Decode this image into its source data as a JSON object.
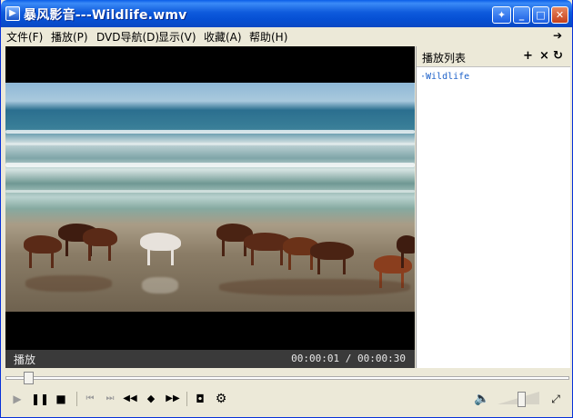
{
  "window": {
    "title": "暴风影音---Wildlife.wmv"
  },
  "menu": {
    "items": [
      "文件(F)",
      "播放(P)",
      "DVD导航(D)",
      "显示(V)",
      "收藏(A)",
      "帮助(H)"
    ]
  },
  "status": {
    "label": "播放",
    "time": "00:00:01 / 00:00:30"
  },
  "playlist": {
    "title": "播放列表",
    "items": [
      "·Wildlife"
    ]
  },
  "playback": {
    "progress": 0.033,
    "volume": 0.6
  },
  "icons": {
    "play": "play-icon",
    "pause": "pause-icon",
    "stop": "stop-icon",
    "prev": "previous-icon",
    "next": "next-icon",
    "rewind": "rewind-icon",
    "slow": "frame-icon",
    "forward": "fast-forward-icon",
    "snapshot": "camera-icon",
    "settings": "gear-icon",
    "volume": "speaker-icon",
    "fullscreen": "fullscreen-icon"
  }
}
